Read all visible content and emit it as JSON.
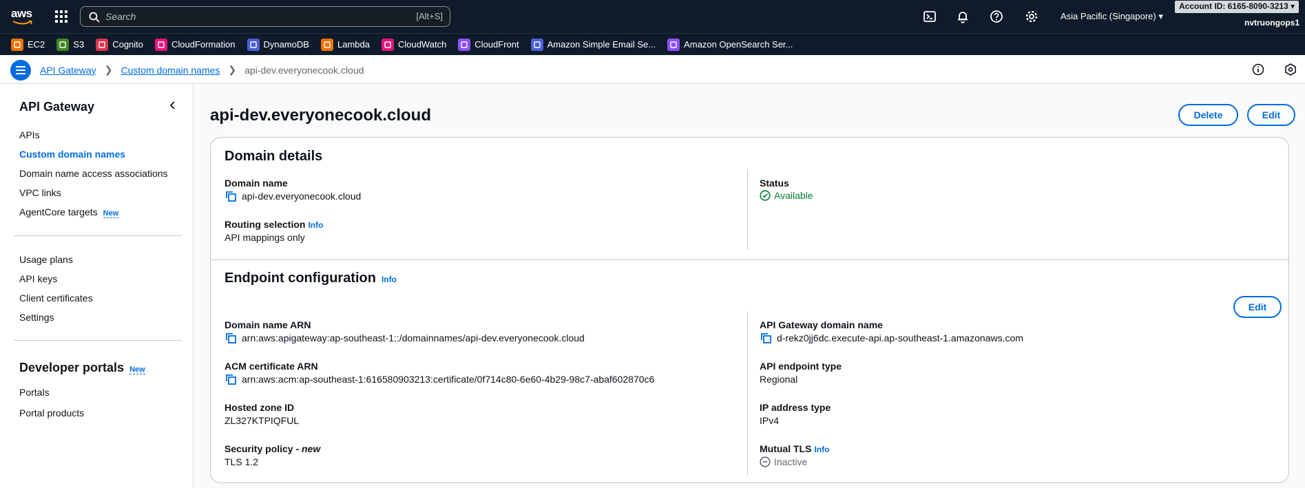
{
  "topnav": {
    "logo_text": "aws",
    "search_placeholder": "Search",
    "search_shortcut": "[Alt+S]",
    "region": "Asia Pacific (Singapore) ▾",
    "account": "Account ID: 6165-8090-3213 ▾",
    "username": "nvtruongops1"
  },
  "favorites": [
    {
      "label": "EC2",
      "color": "#ed7100",
      "icon": "ec2-icon"
    },
    {
      "label": "S3",
      "color": "#3f8624",
      "icon": "s3-icon"
    },
    {
      "label": "Cognito",
      "color": "#dd344c",
      "icon": "cognito-icon"
    },
    {
      "label": "CloudFormation",
      "color": "#e7157b",
      "icon": "cloudformation-icon"
    },
    {
      "label": "DynamoDB",
      "color": "#4d5fd5",
      "icon": "dynamodb-icon"
    },
    {
      "label": "Lambda",
      "color": "#ed7100",
      "icon": "lambda-icon"
    },
    {
      "label": "CloudWatch",
      "color": "#e7157b",
      "icon": "cloudwatch-icon"
    },
    {
      "label": "CloudFront",
      "color": "#8c4fff",
      "icon": "cloudfront-icon"
    },
    {
      "label": "Amazon Simple Email Se...",
      "color": "#4d5fd5",
      "icon": "ses-icon"
    },
    {
      "label": "Amazon OpenSearch Ser...",
      "color": "#8c4fff",
      "icon": "opensearch-icon"
    }
  ],
  "breadcrumb": {
    "items": [
      "API Gateway",
      "Custom domain names"
    ],
    "current": "api-dev.everyonecook.cloud"
  },
  "sidebar": {
    "title": "API Gateway",
    "group1": [
      "APIs",
      "Custom domain names",
      "Domain name access associations",
      "VPC links",
      "AgentCore targets"
    ],
    "new_badge": "New",
    "group2": [
      "Usage plans",
      "API keys",
      "Client certificates",
      "Settings"
    ],
    "section2_title": "Developer portals",
    "group3": [
      "Portals",
      "Portal products"
    ]
  },
  "page": {
    "title": "api-dev.everyonecook.cloud",
    "delete_label": "Delete",
    "edit_label": "Edit"
  },
  "domain_details": {
    "heading": "Domain details",
    "domain_name_label": "Domain name",
    "domain_name_value": "api-dev.everyonecook.cloud",
    "routing_label": "Routing selection",
    "info_label": "Info",
    "routing_value": "API mappings only",
    "status_label": "Status",
    "status_value": "Available"
  },
  "endpoint": {
    "heading": "Endpoint configuration",
    "info_label": "Info",
    "edit_label": "Edit",
    "arn_label": "Domain name ARN",
    "arn_value": "arn:aws:apigateway:ap-southeast-1::/domainnames/api-dev.everyonecook.cloud",
    "acm_label": "ACM certificate ARN",
    "acm_value": "arn:aws:acm:ap-southeast-1:616580903213:certificate/0f714c80-6e60-4b29-98c7-abaf602870c6",
    "zone_label": "Hosted zone ID",
    "zone_value": "ZL327KTPIQFUL",
    "policy_label": "Security policy - ",
    "policy_new": "new",
    "policy_value": "TLS 1.2",
    "apigw_label": "API Gateway domain name",
    "apigw_value": "d-rekz0jj6dc.execute-api.ap-southeast-1.amazonaws.com",
    "type_label": "API endpoint type",
    "type_value": "Regional",
    "ip_label": "IP address type",
    "ip_value": "IPv4",
    "mtls_label": "Mutual TLS",
    "mtls_value": "Inactive"
  }
}
